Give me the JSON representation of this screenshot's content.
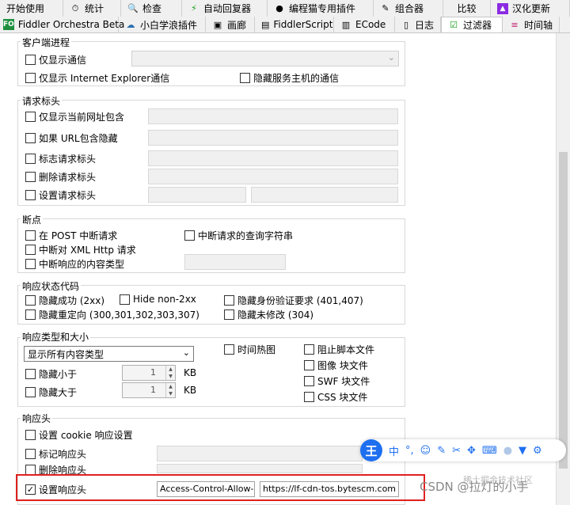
{
  "tabs_row1": [
    {
      "label": "开始使用",
      "icon": "none"
    },
    {
      "label": "统计",
      "icon": "clock-icon"
    },
    {
      "label": "检查",
      "icon": "inspect-icon"
    },
    {
      "label": "自动回复器",
      "icon": "lightning-icon"
    },
    {
      "label": "编程猫专用插件",
      "icon": "cat-icon"
    },
    {
      "label": "组合器",
      "icon": "compose-icon"
    },
    {
      "label": "比较",
      "icon": "none"
    },
    {
      "label": "汉化更新",
      "icon": "update-icon"
    }
  ],
  "tabs_row2": [
    {
      "label": "Fiddler Orchestra Beta",
      "badge": "FO"
    },
    {
      "label": "小白学浪插件",
      "icon": "cloud-icon"
    },
    {
      "label": "画廊",
      "icon": "gallery-icon"
    },
    {
      "label": "FiddlerScript",
      "icon": "script-icon"
    },
    {
      "label": "ECode",
      "icon": "ecode-icon"
    },
    {
      "label": "日志",
      "icon": "log-icon"
    },
    {
      "label": "过滤器",
      "icon": "check-icon",
      "active": true
    },
    {
      "label": "时间轴",
      "icon": "timeline-icon"
    }
  ],
  "client": {
    "title": "客户端进程",
    "only_show": "仅显示通信",
    "only_ie": "仅显示 Internet Explorer通信",
    "hide_service": "隐藏服务主机的通信"
  },
  "req_headers": {
    "title": "请求标头",
    "url_contains": "仅显示当前网址包含",
    "url_hide": "如果 URL包含隐藏",
    "flag": "标志请求标头",
    "delete": "删除请求标头",
    "set": "设置请求标头"
  },
  "breakpoints": {
    "title": "断点",
    "post": "在 POST 中断请求",
    "query": "中断请求的查询字符串",
    "xml": "中断对 XML Http 请求",
    "ctype": "中断响应的内容类型"
  },
  "status": {
    "title": "响应状态代码",
    "hide_success": "隐藏成功 (2xx)",
    "hide_non2xx": "Hide non-2xx",
    "hide_auth": "隐藏身份验证要求 (401,407)",
    "hide_redirect": "隐藏重定向 (300,301,302,303,307)",
    "hide_unmod": "隐藏未修改 (304)"
  },
  "types": {
    "title": "响应类型和大小",
    "select": "显示所有内容类型",
    "hide_smaller": "隐藏小于",
    "hide_larger": "隐藏大于",
    "val1": "1",
    "val2": "1",
    "kb": "KB",
    "time_heat": "时间热图",
    "block_script": "阻止脚本文件",
    "image_block": "图像 块文件",
    "swf_block": "SWF 块文件",
    "css_block": "CSS 块文件"
  },
  "resp_headers": {
    "title": "响应头",
    "cookie": "设置 cookie 响应设置",
    "flag": "标记响应头",
    "delete": "删除响应头",
    "set": "设置响应头",
    "name_value": "Access-Control-Allow-Ori",
    "value_value": "https://lf-cdn-tos.bytescm.com"
  },
  "toolbar": {
    "logo": "王",
    "zh": "中",
    "punct": "°,"
  },
  "watermark": {
    "text": "CSDN @拉灯的小手",
    "faint": "稀土掘金技术社区"
  },
  "colors": {
    "red": "#e02020",
    "blue": "#1e6ff0"
  }
}
